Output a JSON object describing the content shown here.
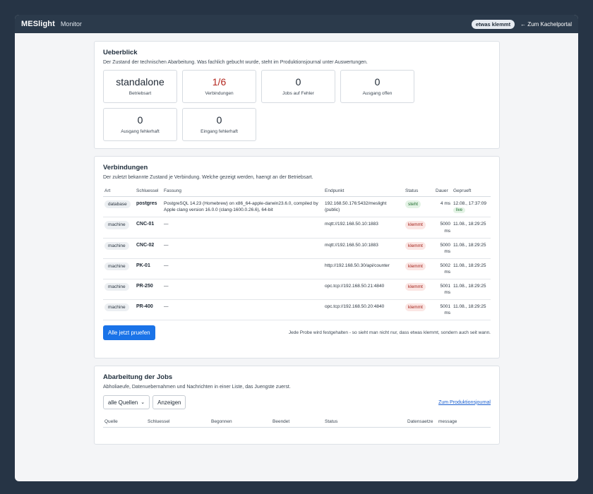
{
  "header": {
    "brand": "MESlight",
    "subtitle": "Monitor",
    "status_pill": "etwas klemmt",
    "back_link": "← Zum Kachelportal"
  },
  "overview": {
    "title": "Ueberblick",
    "description": "Der Zustand der technischen Abarbeitung. Was fachlich gebucht wurde, steht im Produktionsjournal unter Auswertungen.",
    "tiles": [
      {
        "value": "standalone",
        "label": "Betriebsart"
      },
      {
        "value": "1/6",
        "label": "Verbindungen"
      },
      {
        "value": "0",
        "label": "Jobs auf Fehler"
      },
      {
        "value": "0",
        "label": "Ausgang offen"
      },
      {
        "value": "0",
        "label": "Ausgang fehlerhaft"
      },
      {
        "value": "0",
        "label": "Eingang fehlerhaft"
      }
    ]
  },
  "connections": {
    "title": "Verbindungen",
    "description": "Der zuletzt bekannte Zustand je Verbindung. Welche gezeigt werden, haengt an der Betriebsart.",
    "columns": [
      "Art",
      "Schluessel",
      "Fassung",
      "Endpunkt",
      "Status",
      "Dauer",
      "Geprueft"
    ],
    "rows": [
      {
        "art": "database",
        "key": "postgres",
        "fassung": "PostgreSQL 14.23 (Homebrew) on x86_64-apple-darwin23.6.0, compiled by Apple clang version 16.0.0 (clang-1600.0.26.6), 64-bit",
        "endpoint": "192.168.50.176:5432/meslight (public)",
        "status": "steht",
        "duration": "4 ms",
        "checked": "12.08., 17:37:09",
        "live": "live"
      },
      {
        "art": "machine",
        "key": "CNC-01",
        "fassung": "—",
        "endpoint": "mqtt://192.168.50.10:1883",
        "status": "klemmt",
        "duration": "5000 ms",
        "checked": "11.08., 18:29:25"
      },
      {
        "art": "machine",
        "key": "CNC-02",
        "fassung": "—",
        "endpoint": "mqtt://192.168.50.10:1883",
        "status": "klemmt",
        "duration": "5000 ms",
        "checked": "11.08., 18:29:25"
      },
      {
        "art": "machine",
        "key": "PK-01",
        "fassung": "—",
        "endpoint": "http://192.168.50.30/api/counter",
        "status": "klemmt",
        "duration": "5002 ms",
        "checked": "11.08., 18:29:25"
      },
      {
        "art": "machine",
        "key": "PR-250",
        "fassung": "—",
        "endpoint": "opc.tcp://192.168.50.21:4840",
        "status": "klemmt",
        "duration": "5001 ms",
        "checked": "11.08., 18:29:25"
      },
      {
        "art": "machine",
        "key": "PR-400",
        "fassung": "—",
        "endpoint": "opc.tcp://192.168.50.20:4840",
        "status": "klemmt",
        "duration": "5001 ms",
        "checked": "11.08., 18:29:25"
      }
    ],
    "check_all_button": "Alle jetzt pruefen",
    "note": "Jede Probe wird festgehalten - so sieht man nicht nur, dass etwas klemmt, sondern auch seit wann."
  },
  "jobs": {
    "title": "Abarbeitung der Jobs",
    "description": "Abholiaeufe, Datenuebernahmen und Nachrichten in einer Liste, das Juengste zuerst.",
    "filter_value": "alle Quellen",
    "show_button": "Anzeigen",
    "journal_link": "Zum Produktionsjournal",
    "columns": [
      "Quelle",
      "Schluessel",
      "Begonnen",
      "Beendet",
      "Status",
      "Datensaetze",
      "message"
    ]
  },
  "colors": {
    "accent": "#1a73e8",
    "topbar": "#2b3a4b",
    "status_ok": "#1f6e2e",
    "status_bad": "#a3221a"
  }
}
